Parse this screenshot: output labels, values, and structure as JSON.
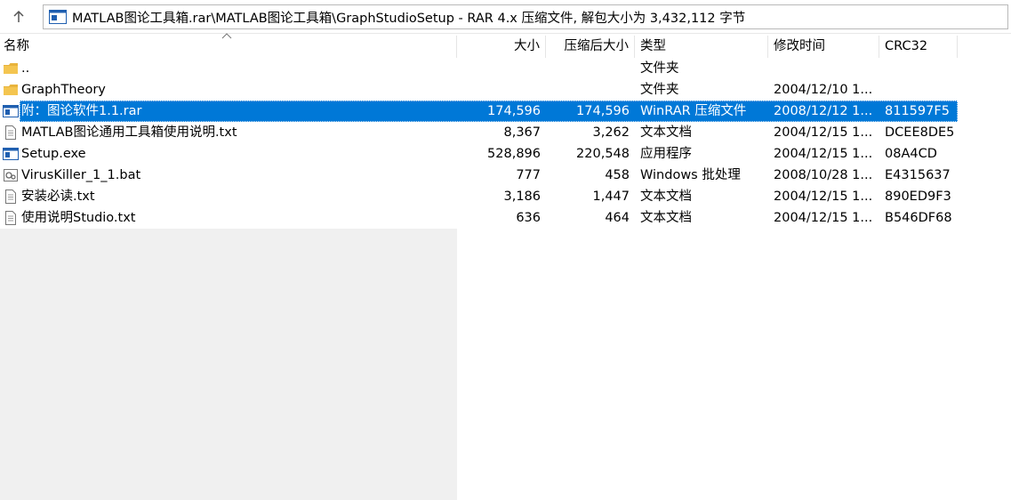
{
  "address": {
    "path": "MATLAB图论工具箱.rar\\MATLAB图论工具箱\\GraphStudioSetup - RAR 4.x 压缩文件, 解包大小为 3,432,112 字节"
  },
  "columns": {
    "name": "名称",
    "size": "大小",
    "packed": "压缩后大小",
    "type": "类型",
    "modified": "修改时间",
    "crc": "CRC32"
  },
  "files": [
    {
      "name": "..",
      "size": "",
      "packed": "",
      "type": "文件夹",
      "modified": "",
      "crc": "",
      "icon": "folder-icon"
    },
    {
      "name": "GraphTheory",
      "size": "",
      "packed": "",
      "type": "文件夹",
      "modified": "2004/12/10 1...",
      "crc": "",
      "icon": "folder-icon"
    },
    {
      "name": "附：图论软件1.1.rar",
      "size": "174,596",
      "packed": "174,596",
      "type": "WinRAR 压缩文件",
      "modified": "2008/12/12 1...",
      "crc": "811597F5",
      "icon": "archive-icon",
      "selected": true
    },
    {
      "name": "MATLAB图论通用工具箱使用说明.txt",
      "size": "8,367",
      "packed": "3,262",
      "type": "文本文档",
      "modified": "2004/12/15 1...",
      "crc": "DCEE8DE5",
      "icon": "text-file-icon"
    },
    {
      "name": "Setup.exe",
      "size": "528,896",
      "packed": "220,548",
      "type": "应用程序",
      "modified": "2004/12/15 1...",
      "crc": "08A4CD",
      "icon": "exe-icon"
    },
    {
      "name": "VirusKiller_1_1.bat",
      "size": "777",
      "packed": "458",
      "type": "Windows 批处理",
      "modified": "2008/10/28 1...",
      "crc": "E4315637",
      "icon": "batch-file-icon"
    },
    {
      "name": "安装必读.txt",
      "size": "3,186",
      "packed": "1,447",
      "type": "文本文档",
      "modified": "2004/12/15 1...",
      "crc": "890ED9F3",
      "icon": "text-file-icon"
    },
    {
      "name": "使用说明Studio.txt",
      "size": "636",
      "packed": "464",
      "type": "文本文档",
      "modified": "2004/12/15 1...",
      "crc": "B546DF68",
      "icon": "text-file-icon"
    }
  ],
  "colors": {
    "selection": "#0078d7",
    "folder": "#e8b33c"
  }
}
